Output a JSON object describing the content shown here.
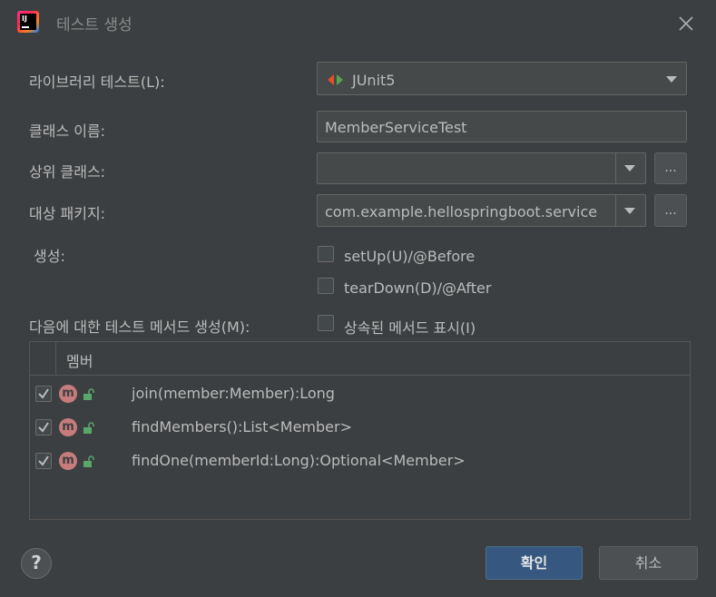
{
  "window": {
    "title": "테스트 생성",
    "app_icon_text": "IJ"
  },
  "form": {
    "library_label": "라이브러리 테스트(L):",
    "library_value": "JUnit5",
    "class_name_label": "클래스 이름:",
    "class_name_value": "MemberServiceTest",
    "superclass_label": "상위 클래스:",
    "superclass_value": "",
    "package_label": "대상 패키지:",
    "package_value": "com.example.hellospringboot.service",
    "browse_label": "...",
    "generate_label": "생성:",
    "setup_label": "setUp(U)/@Before",
    "setup_checked": false,
    "teardown_label": "tearDown(D)/@After",
    "teardown_checked": false,
    "methods_label": "다음에 대한 테스트 메서드 생성(M):",
    "show_inherited_label": "상속된 메서드 표시(I)",
    "show_inherited_checked": false
  },
  "table": {
    "header": "멤버",
    "rows": [
      {
        "checked": true,
        "icon": "method-icon",
        "icon_letter": "m",
        "signature": "join(member:Member):Long"
      },
      {
        "checked": true,
        "icon": "method-icon",
        "icon_letter": "m",
        "signature": "findMembers():List<Member>"
      },
      {
        "checked": true,
        "icon": "method-icon",
        "icon_letter": "m",
        "signature": "findOne(memberId:Long):Optional<Member>"
      }
    ]
  },
  "footer": {
    "help_label": "?",
    "ok_label": "확인",
    "cancel_label": "취소"
  },
  "colors": {
    "background": "#3c3f41",
    "field": "#45494a",
    "primary_button": "#365880",
    "method_icon": "#c77b7b",
    "check": "#bbbbbb"
  }
}
